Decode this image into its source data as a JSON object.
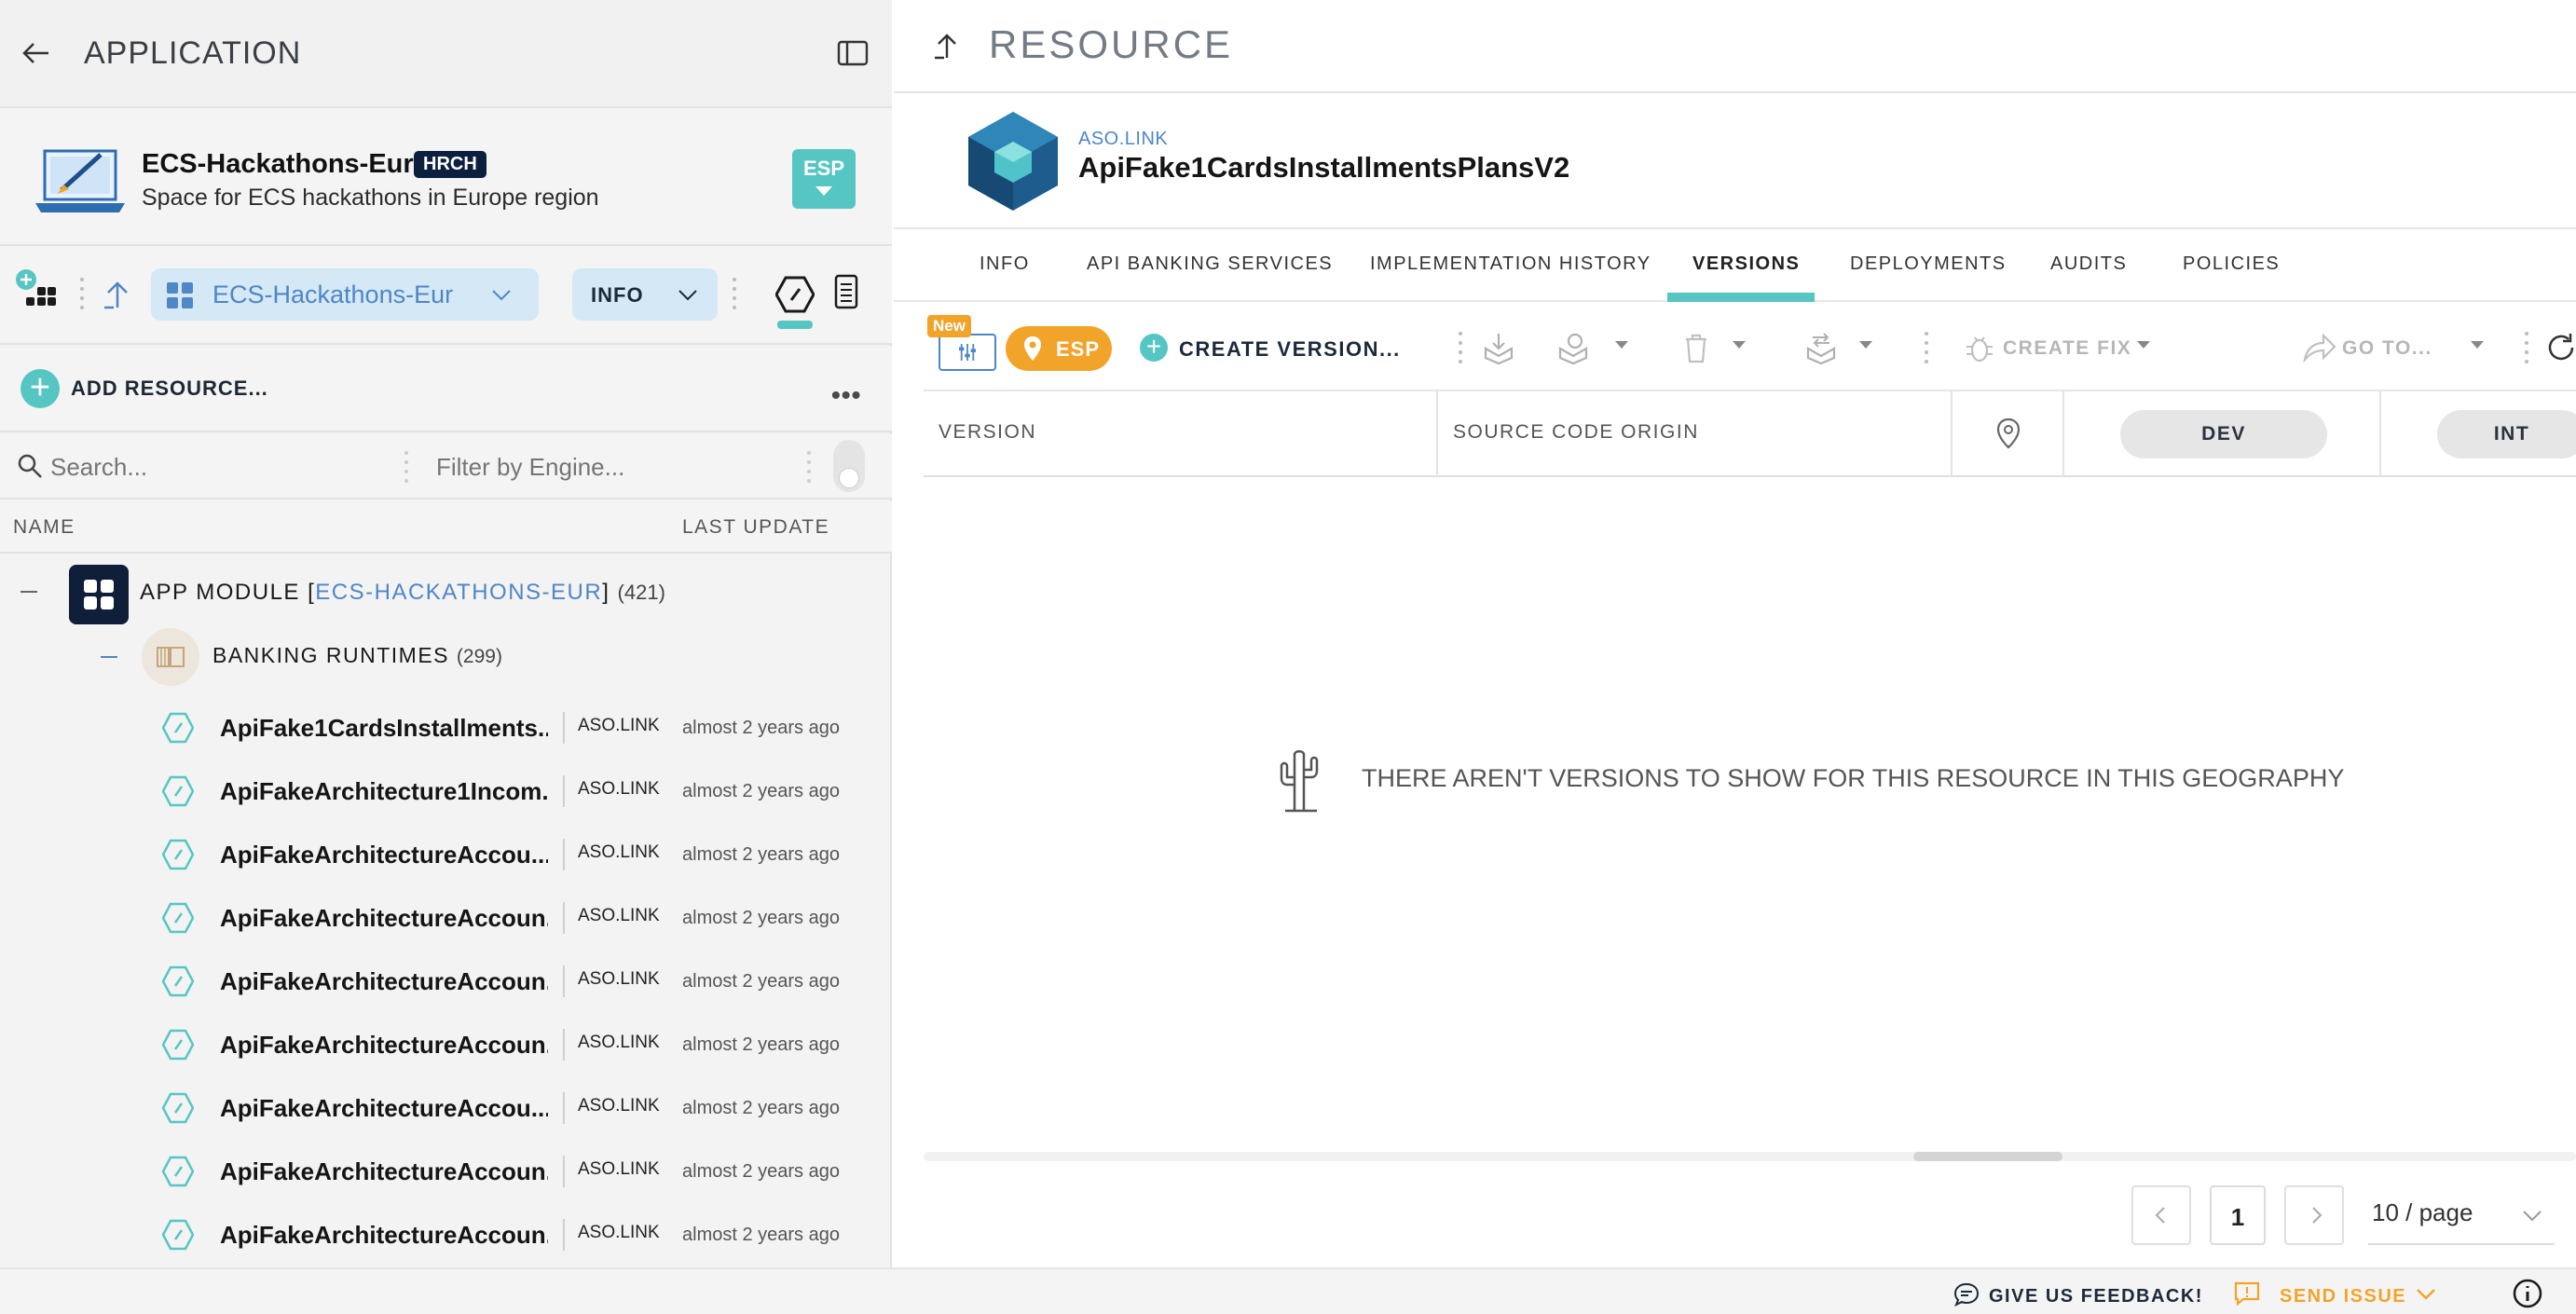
{
  "left_panel": {
    "title": "APPLICATION",
    "app": {
      "name": "ECS-Hackathons-Eur",
      "tag": "HRCH",
      "description": "Space for ECS hackathons in Europe region",
      "geo_badge": "ESP"
    },
    "toolbar": {
      "app_select": "ECS-Hackathons-Eur",
      "view_select": "INFO"
    },
    "add_resource_label": "ADD RESOURCE...",
    "more_label": "•••",
    "search": {
      "placeholder": "Search...",
      "filter_placeholder": "Filter by Engine..."
    },
    "columns": {
      "name": "NAME",
      "last_update": "LAST UPDATE"
    },
    "tree": {
      "module": {
        "prefix": "APP MODULE [",
        "link": "ECS-HACKATHONS-EUR",
        "suffix": "]",
        "count": "(421)"
      },
      "group": {
        "label": "BANKING RUNTIMES",
        "count": "(299)"
      },
      "items": [
        {
          "name": "ApiFake1CardsInstallments...",
          "tag": "ASO.LINK",
          "time": "almost 2 years ago"
        },
        {
          "name": "ApiFakeArchitecture1Incom...",
          "tag": "ASO.LINK",
          "time": "almost 2 years ago"
        },
        {
          "name": "ApiFakeArchitectureAccou...",
          "tag": "ASO.LINK",
          "time": "almost 2 years ago"
        },
        {
          "name": "ApiFakeArchitectureAccoun...",
          "tag": "ASO.LINK",
          "time": "almost 2 years ago"
        },
        {
          "name": "ApiFakeArchitectureAccoun...",
          "tag": "ASO.LINK",
          "time": "almost 2 years ago"
        },
        {
          "name": "ApiFakeArchitectureAccoun...",
          "tag": "ASO.LINK",
          "time": "almost 2 years ago"
        },
        {
          "name": "ApiFakeArchitectureAccou...",
          "tag": "ASO.LINK",
          "time": "almost 2 years ago"
        },
        {
          "name": "ApiFakeArchitectureAccoun...",
          "tag": "ASO.LINK",
          "time": "almost 2 years ago"
        },
        {
          "name": "ApiFakeArchitectureAccoun...",
          "tag": "ASO.LINK",
          "time": "almost 2 years ago"
        }
      ]
    }
  },
  "right_panel": {
    "title": "RESOURCE",
    "resource": {
      "parent": "ASO.LINK",
      "name": "ApiFake1CardsInstallmentsPlansV2"
    },
    "tabs": [
      "INFO",
      "API BANKING SERVICES",
      "IMPLEMENTATION HISTORY",
      "VERSIONS",
      "DEPLOYMENTS",
      "AUDITS",
      "POLICIES"
    ],
    "active_tab": "VERSIONS",
    "toolbar": {
      "new_badge": "New",
      "geo": "ESP",
      "create_version": "CREATE VERSION...",
      "create_fix": "CREATE FIX",
      "go_to": "GO TO..."
    },
    "table": {
      "columns": [
        "VERSION",
        "SOURCE CODE ORIGIN"
      ],
      "environments": [
        "DEV",
        "INT"
      ]
    },
    "empty_message": "THERE AREN'T VERSIONS TO SHOW FOR THIS RESOURCE IN THIS GEOGRAPHY",
    "pagination": {
      "page": "1",
      "page_size": "10 / page"
    }
  },
  "footer": {
    "feedback": "GIVE US FEEDBACK!",
    "send_issue": "SEND ISSUE"
  },
  "colors": {
    "accent_teal": "#56c6c3",
    "accent_orange": "#f2a42a",
    "link_blue": "#4f86c6",
    "navy": "#0f1f39"
  }
}
